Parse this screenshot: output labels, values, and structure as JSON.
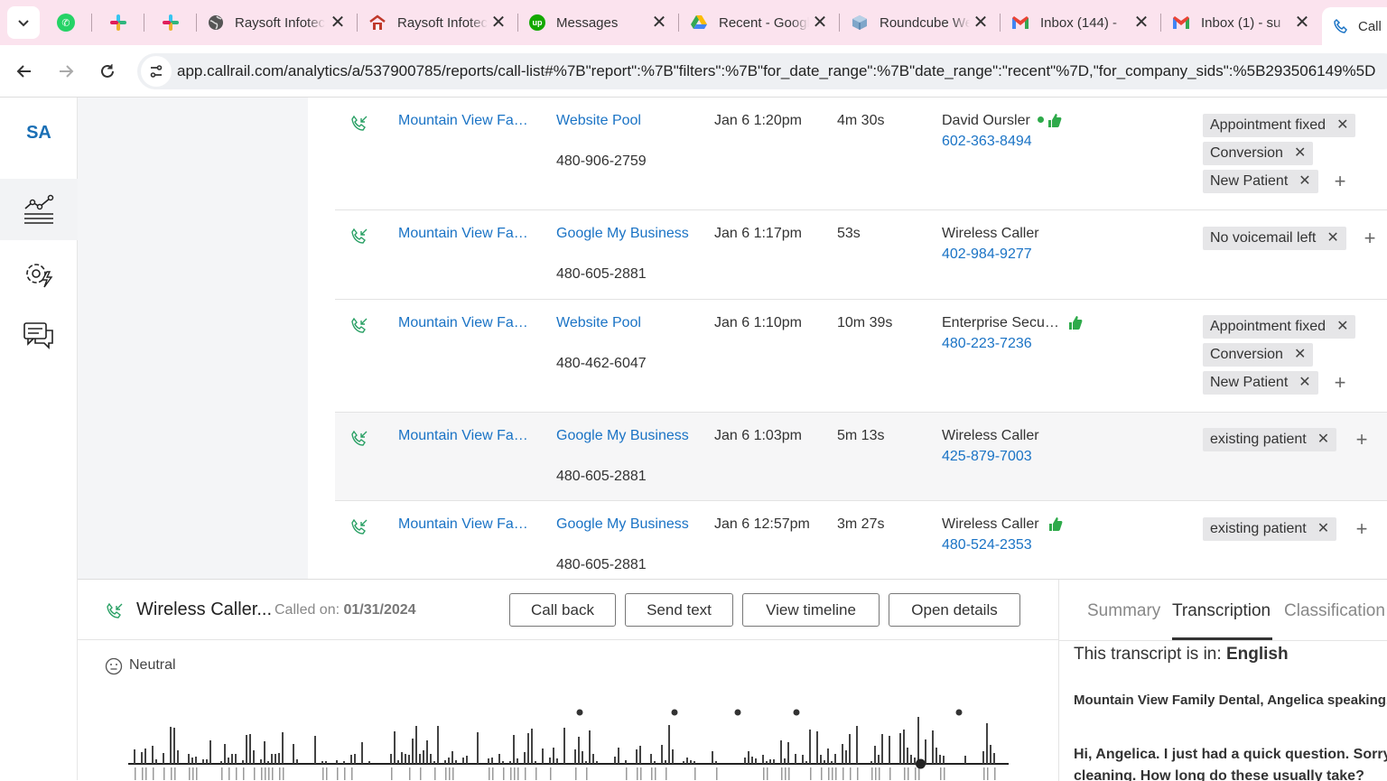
{
  "browser": {
    "tabs": [
      {
        "title": "",
        "icon": "whatsapp-icon"
      },
      {
        "title": "",
        "icon": "slack-icon"
      },
      {
        "title": "",
        "icon": "slack-icon"
      },
      {
        "title": "Raysoft Infotech",
        "icon": "globe-icon"
      },
      {
        "title": "Raysoft Infotech",
        "icon": "raysoft-icon"
      },
      {
        "title": "Messages",
        "icon": "upwork-icon"
      },
      {
        "title": "Recent - Google Drive",
        "icon": "google-drive-icon"
      },
      {
        "title": "Roundcube Webmail",
        "icon": "roundcube-icon"
      },
      {
        "title": "Inbox (144) -",
        "icon": "gmail-icon"
      },
      {
        "title": "Inbox (1) - su",
        "icon": "gmail-icon"
      },
      {
        "title": "Call",
        "icon": "callrail-icon"
      }
    ],
    "url": "app.callrail.com/analytics/a/537900785/reports/call-list#%7B\"report\":%7B\"filters\":%7B\"for_date_range\":%7B\"date_range\":\"recent\"%7D,\"for_company_sids\":%5B293506149%5D"
  },
  "sidebar": {
    "logo": "SA",
    "items": [
      "analytics-icon",
      "settings-bolt-icon",
      "chat-icon"
    ]
  },
  "calls": [
    {
      "company": "Mountain View Fa…",
      "source": "Website Pool",
      "tracking_number": "480-906-2759",
      "date": "Jan 6 1:20pm",
      "duration": "4m 30s",
      "caller": "David Oursler",
      "caller_phone": "602-363-8494",
      "online": true,
      "thumbs_up": true,
      "tags": [
        "Appointment fixed",
        "Conversion",
        "New Patient"
      ]
    },
    {
      "company": "Mountain View Fa…",
      "source": "Google My Business",
      "tracking_number": "480-605-2881",
      "date": "Jan 6 1:17pm",
      "duration": "53s",
      "caller": "Wireless Caller",
      "caller_phone": "402-984-9277",
      "online": false,
      "thumbs_up": false,
      "tags": [
        "No voicemail left"
      ]
    },
    {
      "company": "Mountain View Fa…",
      "source": "Website Pool",
      "tracking_number": "480-462-6047",
      "date": "Jan 6 1:10pm",
      "duration": "10m 39s",
      "caller": "Enterprise Secu…",
      "caller_phone": "480-223-7236",
      "online": false,
      "thumbs_up": true,
      "tags": [
        "Appointment fixed",
        "Conversion",
        "New Patient"
      ]
    },
    {
      "company": "Mountain View Fa…",
      "source": "Google My Business",
      "tracking_number": "480-605-2881",
      "date": "Jan 6 1:03pm",
      "duration": "5m 13s",
      "caller": "Wireless Caller",
      "caller_phone": "425-879-7003",
      "online": false,
      "thumbs_up": false,
      "tags": [
        "existing patient"
      ]
    },
    {
      "company": "Mountain View Fa…",
      "source": "Google My Business",
      "tracking_number": "480-605-2881",
      "date": "Jan 6 12:57pm",
      "duration": "3m 27s",
      "caller": "Wireless Caller",
      "caller_phone": "480-524-2353",
      "online": false,
      "thumbs_up": true,
      "tags": [
        "existing patient"
      ]
    }
  ],
  "detail": {
    "caller": "Wireless Caller...",
    "called_on_label": "Called on:",
    "called_on_date": "01/31/2024",
    "buttons": {
      "call_back": "Call back",
      "send_text": "Send text",
      "view_timeline": "View timeline",
      "open_details": "Open details"
    },
    "sentiment": "Neutral",
    "tabs": {
      "summary": "Summary",
      "transcription": "Transcription",
      "classification": "Classification"
    },
    "transcript_lang_label": "This transcript is in:",
    "transcript_lang": "English",
    "speaker_line": "Mountain View Family Dental, Angelica speaking.",
    "caller_line": "Hi, Angelica. I just had a quick question. Sorry.",
    "caller_line_2": "cleaning. How long do these usually take?",
    "waveform_progress": 0.9
  },
  "colors": {
    "accent": "#1a73c5",
    "thumb": "#2eaa4a",
    "tag_bg": "#e6e6e8"
  }
}
